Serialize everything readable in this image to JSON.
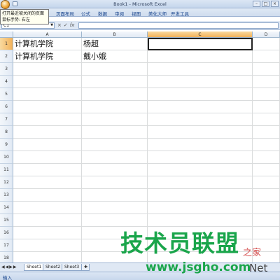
{
  "window": {
    "title": "Book1 - Microsoft Excel",
    "buttons": [
      "–",
      "□",
      "×"
    ]
  },
  "ribbon": {
    "tabs": [
      "插入",
      "页面布局",
      "公式",
      "数据",
      "审阅",
      "视图",
      "美化大师",
      "开发工具"
    ]
  },
  "tooltip": {
    "line1": "打开最近被关闭的页面",
    "line2": "鼠标手势: 右左"
  },
  "formula_bar": {
    "name_box": "C1",
    "fx_symbols": [
      "×",
      "✓",
      "fx"
    ],
    "value": ""
  },
  "columns": [
    "A",
    "B",
    "C",
    "D"
  ],
  "active_cell": "C1",
  "rows": [
    {
      "num": "1",
      "A": "计算机学院",
      "B": "杨超",
      "C": ""
    },
    {
      "num": "2",
      "A": "计算机学院",
      "B": "戴小娥",
      "C": ""
    },
    {
      "num": "3",
      "A": "",
      "B": "",
      "C": ""
    },
    {
      "num": "4",
      "A": "",
      "B": "",
      "C": ""
    },
    {
      "num": "5",
      "A": "",
      "B": "",
      "C": ""
    },
    {
      "num": "6",
      "A": "",
      "B": "",
      "C": ""
    },
    {
      "num": "7",
      "A": "",
      "B": "",
      "C": ""
    },
    {
      "num": "8",
      "A": "",
      "B": "",
      "C": ""
    },
    {
      "num": "9",
      "A": "",
      "B": "",
      "C": ""
    },
    {
      "num": "10",
      "A": "",
      "B": "",
      "C": ""
    },
    {
      "num": "11",
      "A": "",
      "B": "",
      "C": ""
    },
    {
      "num": "12",
      "A": "",
      "B": "",
      "C": ""
    },
    {
      "num": "13",
      "A": "",
      "B": "",
      "C": ""
    },
    {
      "num": "14",
      "A": "",
      "B": "",
      "C": ""
    },
    {
      "num": "15",
      "A": "",
      "B": "",
      "C": ""
    },
    {
      "num": "16",
      "A": "",
      "B": "",
      "C": ""
    },
    {
      "num": "17",
      "A": "",
      "B": "",
      "C": ""
    },
    {
      "num": "18",
      "A": "",
      "B": "",
      "C": ""
    }
  ],
  "sheets": [
    "Sheet1",
    "Sheet2",
    "Sheet3"
  ],
  "active_sheet": "Sheet1",
  "status": "输入",
  "watermark": {
    "main": "技术员联盟",
    "url": "www.jsgho.com",
    "side": "之家",
    "net": "Net"
  },
  "colors": {
    "active_header": "#f2b25a",
    "ribbon_text": "#15428b",
    "watermark": "#1aa54b"
  }
}
